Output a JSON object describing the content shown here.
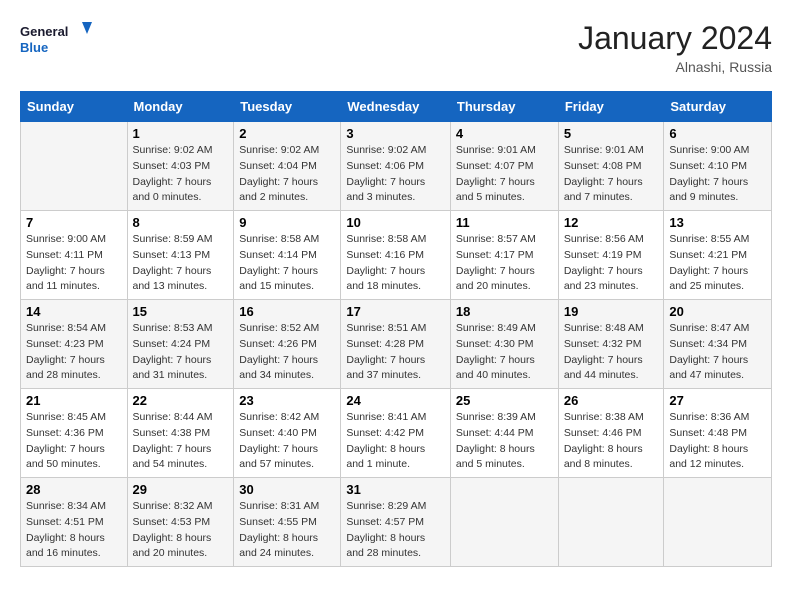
{
  "header": {
    "logo_line1": "General",
    "logo_line2": "Blue",
    "month_year": "January 2024",
    "location": "Alnashi, Russia"
  },
  "weekdays": [
    "Sunday",
    "Monday",
    "Tuesday",
    "Wednesday",
    "Thursday",
    "Friday",
    "Saturday"
  ],
  "weeks": [
    [
      {
        "day": "",
        "sunrise": "",
        "sunset": "",
        "daylight": ""
      },
      {
        "day": "1",
        "sunrise": "Sunrise: 9:02 AM",
        "sunset": "Sunset: 4:03 PM",
        "daylight": "Daylight: 7 hours and 0 minutes."
      },
      {
        "day": "2",
        "sunrise": "Sunrise: 9:02 AM",
        "sunset": "Sunset: 4:04 PM",
        "daylight": "Daylight: 7 hours and 2 minutes."
      },
      {
        "day": "3",
        "sunrise": "Sunrise: 9:02 AM",
        "sunset": "Sunset: 4:06 PM",
        "daylight": "Daylight: 7 hours and 3 minutes."
      },
      {
        "day": "4",
        "sunrise": "Sunrise: 9:01 AM",
        "sunset": "Sunset: 4:07 PM",
        "daylight": "Daylight: 7 hours and 5 minutes."
      },
      {
        "day": "5",
        "sunrise": "Sunrise: 9:01 AM",
        "sunset": "Sunset: 4:08 PM",
        "daylight": "Daylight: 7 hours and 7 minutes."
      },
      {
        "day": "6",
        "sunrise": "Sunrise: 9:00 AM",
        "sunset": "Sunset: 4:10 PM",
        "daylight": "Daylight: 7 hours and 9 minutes."
      }
    ],
    [
      {
        "day": "7",
        "sunrise": "Sunrise: 9:00 AM",
        "sunset": "Sunset: 4:11 PM",
        "daylight": "Daylight: 7 hours and 11 minutes."
      },
      {
        "day": "8",
        "sunrise": "Sunrise: 8:59 AM",
        "sunset": "Sunset: 4:13 PM",
        "daylight": "Daylight: 7 hours and 13 minutes."
      },
      {
        "day": "9",
        "sunrise": "Sunrise: 8:58 AM",
        "sunset": "Sunset: 4:14 PM",
        "daylight": "Daylight: 7 hours and 15 minutes."
      },
      {
        "day": "10",
        "sunrise": "Sunrise: 8:58 AM",
        "sunset": "Sunset: 4:16 PM",
        "daylight": "Daylight: 7 hours and 18 minutes."
      },
      {
        "day": "11",
        "sunrise": "Sunrise: 8:57 AM",
        "sunset": "Sunset: 4:17 PM",
        "daylight": "Daylight: 7 hours and 20 minutes."
      },
      {
        "day": "12",
        "sunrise": "Sunrise: 8:56 AM",
        "sunset": "Sunset: 4:19 PM",
        "daylight": "Daylight: 7 hours and 23 minutes."
      },
      {
        "day": "13",
        "sunrise": "Sunrise: 8:55 AM",
        "sunset": "Sunset: 4:21 PM",
        "daylight": "Daylight: 7 hours and 25 minutes."
      }
    ],
    [
      {
        "day": "14",
        "sunrise": "Sunrise: 8:54 AM",
        "sunset": "Sunset: 4:23 PM",
        "daylight": "Daylight: 7 hours and 28 minutes."
      },
      {
        "day": "15",
        "sunrise": "Sunrise: 8:53 AM",
        "sunset": "Sunset: 4:24 PM",
        "daylight": "Daylight: 7 hours and 31 minutes."
      },
      {
        "day": "16",
        "sunrise": "Sunrise: 8:52 AM",
        "sunset": "Sunset: 4:26 PM",
        "daylight": "Daylight: 7 hours and 34 minutes."
      },
      {
        "day": "17",
        "sunrise": "Sunrise: 8:51 AM",
        "sunset": "Sunset: 4:28 PM",
        "daylight": "Daylight: 7 hours and 37 minutes."
      },
      {
        "day": "18",
        "sunrise": "Sunrise: 8:49 AM",
        "sunset": "Sunset: 4:30 PM",
        "daylight": "Daylight: 7 hours and 40 minutes."
      },
      {
        "day": "19",
        "sunrise": "Sunrise: 8:48 AM",
        "sunset": "Sunset: 4:32 PM",
        "daylight": "Daylight: 7 hours and 44 minutes."
      },
      {
        "day": "20",
        "sunrise": "Sunrise: 8:47 AM",
        "sunset": "Sunset: 4:34 PM",
        "daylight": "Daylight: 7 hours and 47 minutes."
      }
    ],
    [
      {
        "day": "21",
        "sunrise": "Sunrise: 8:45 AM",
        "sunset": "Sunset: 4:36 PM",
        "daylight": "Daylight: 7 hours and 50 minutes."
      },
      {
        "day": "22",
        "sunrise": "Sunrise: 8:44 AM",
        "sunset": "Sunset: 4:38 PM",
        "daylight": "Daylight: 7 hours and 54 minutes."
      },
      {
        "day": "23",
        "sunrise": "Sunrise: 8:42 AM",
        "sunset": "Sunset: 4:40 PM",
        "daylight": "Daylight: 7 hours and 57 minutes."
      },
      {
        "day": "24",
        "sunrise": "Sunrise: 8:41 AM",
        "sunset": "Sunset: 4:42 PM",
        "daylight": "Daylight: 8 hours and 1 minute."
      },
      {
        "day": "25",
        "sunrise": "Sunrise: 8:39 AM",
        "sunset": "Sunset: 4:44 PM",
        "daylight": "Daylight: 8 hours and 5 minutes."
      },
      {
        "day": "26",
        "sunrise": "Sunrise: 8:38 AM",
        "sunset": "Sunset: 4:46 PM",
        "daylight": "Daylight: 8 hours and 8 minutes."
      },
      {
        "day": "27",
        "sunrise": "Sunrise: 8:36 AM",
        "sunset": "Sunset: 4:48 PM",
        "daylight": "Daylight: 8 hours and 12 minutes."
      }
    ],
    [
      {
        "day": "28",
        "sunrise": "Sunrise: 8:34 AM",
        "sunset": "Sunset: 4:51 PM",
        "daylight": "Daylight: 8 hours and 16 minutes."
      },
      {
        "day": "29",
        "sunrise": "Sunrise: 8:32 AM",
        "sunset": "Sunset: 4:53 PM",
        "daylight": "Daylight: 8 hours and 20 minutes."
      },
      {
        "day": "30",
        "sunrise": "Sunrise: 8:31 AM",
        "sunset": "Sunset: 4:55 PM",
        "daylight": "Daylight: 8 hours and 24 minutes."
      },
      {
        "day": "31",
        "sunrise": "Sunrise: 8:29 AM",
        "sunset": "Sunset: 4:57 PM",
        "daylight": "Daylight: 8 hours and 28 minutes."
      },
      {
        "day": "",
        "sunrise": "",
        "sunset": "",
        "daylight": ""
      },
      {
        "day": "",
        "sunrise": "",
        "sunset": "",
        "daylight": ""
      },
      {
        "day": "",
        "sunrise": "",
        "sunset": "",
        "daylight": ""
      }
    ]
  ]
}
